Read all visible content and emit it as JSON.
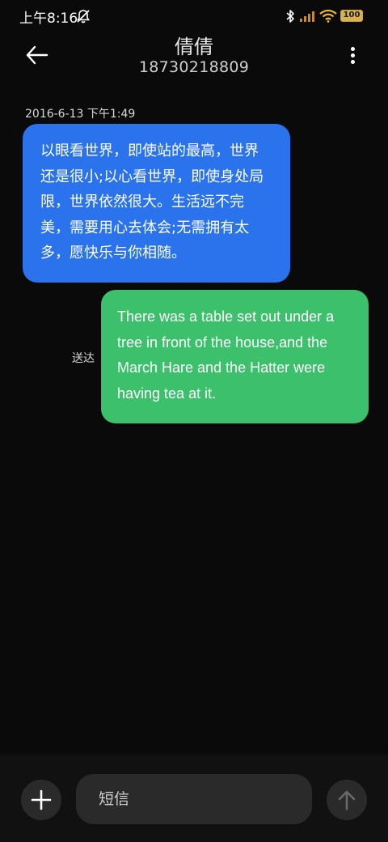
{
  "status_bar": {
    "time": "上午8:16",
    "icons": [
      "mute-icon",
      "bluetooth-icon",
      "signal-icon",
      "wifi-icon",
      "battery-icon"
    ],
    "battery": "100"
  },
  "header": {
    "title": "倩倩",
    "phone": "18730218809"
  },
  "conversation": {
    "timestamp": "2016-6-13 下午1:49",
    "messages": [
      {
        "direction": "incoming",
        "text": "以眼看世界，即使站的最高，世界还是很小;以心看世界，即使身处局限，世界依然很大。生活远不完美，需要用心去体会;无需拥有太多，愿快乐与你相随。",
        "color": "#2a73ec"
      },
      {
        "direction": "outgoing",
        "text": "There was a table set out under a tree in front of the house,and the March Hare and the Hatter were having tea at it.",
        "status": "送达",
        "color": "#3cc06b"
      }
    ]
  },
  "composer": {
    "placeholder": "短信",
    "add_icon": "plus-icon",
    "send_icon": "arrow-up-icon"
  }
}
